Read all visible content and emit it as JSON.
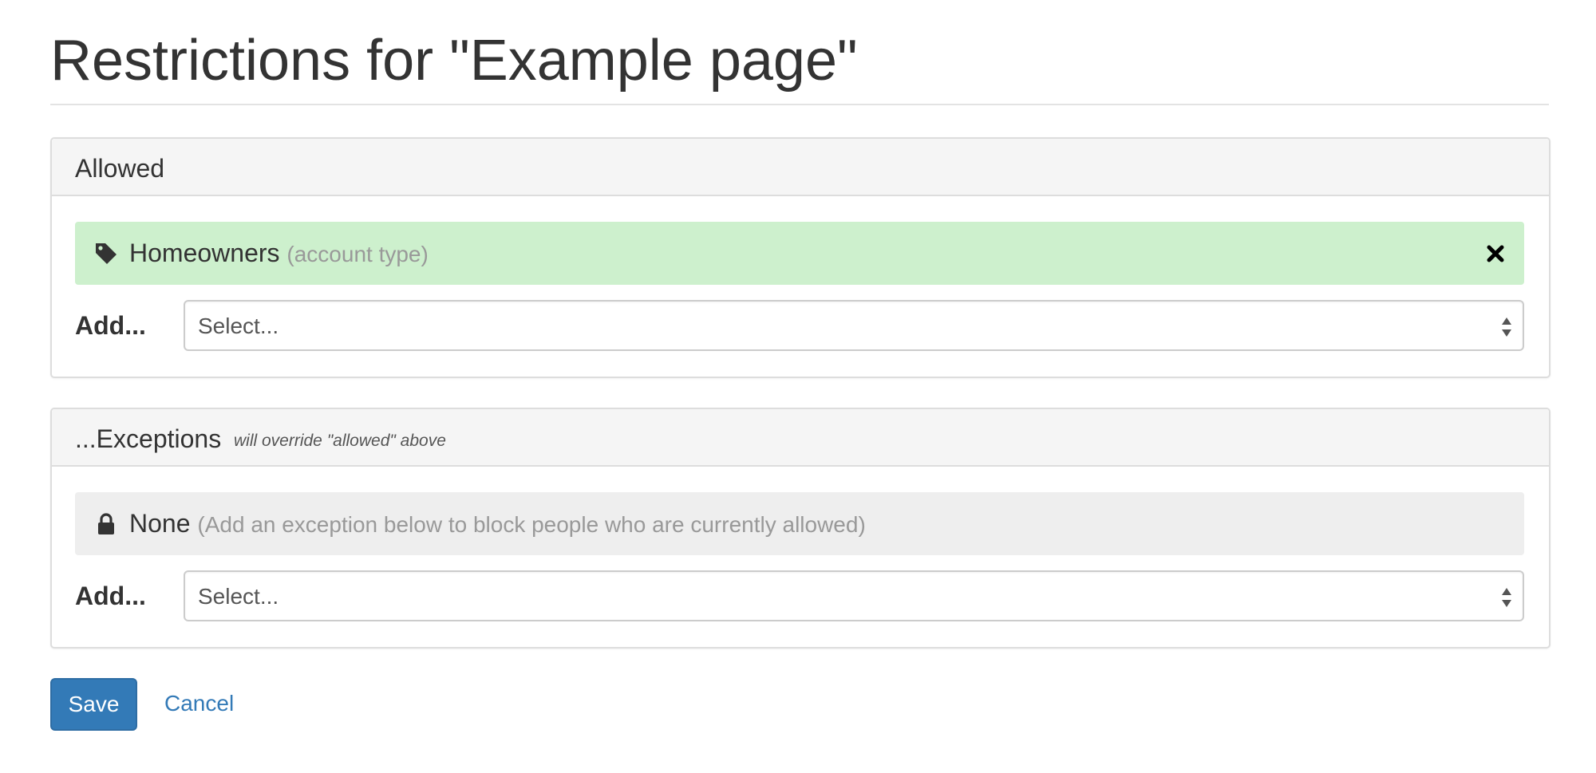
{
  "page": {
    "title": "Restrictions for \"Example page\""
  },
  "allowed": {
    "heading": "Allowed",
    "items": [
      {
        "name": "Homeowners",
        "type": "(account type)",
        "icon": "tag-icon",
        "remove_icon": "close-icon"
      }
    ],
    "add_label": "Add...",
    "select_value": "Select..."
  },
  "exceptions": {
    "heading": "...Exceptions",
    "note": "will override \"allowed\" above",
    "items": [
      {
        "name": "None",
        "type": "(Add an exception below to block people who are currently allowed)",
        "icon": "lock-icon"
      }
    ],
    "add_label": "Add...",
    "select_value": "Select..."
  },
  "actions": {
    "save_label": "Save",
    "cancel_label": "Cancel"
  },
  "colors": {
    "allowed_bg": "#cdf0cd",
    "exception_bg": "#eeeeee",
    "primary": "#337ab7",
    "link": "#337ab7"
  }
}
